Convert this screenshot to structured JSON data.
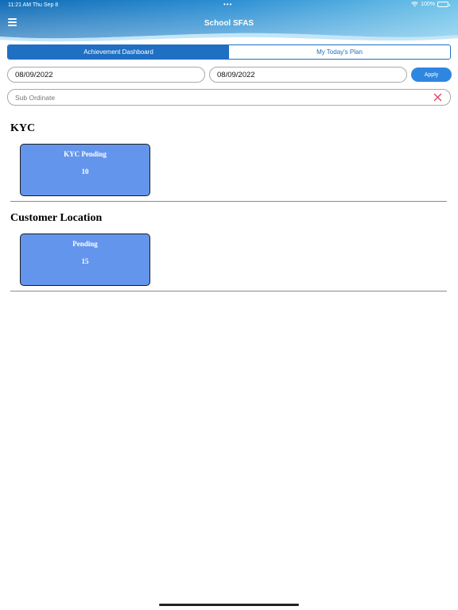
{
  "status_bar": {
    "time_date": "11:21 AM   Thu Sep 8",
    "dots": "•••",
    "battery_text": "100%",
    "battery_level": 1.0
  },
  "header": {
    "title": "School SFAS",
    "menu_icon": "hamburger-menu-icon",
    "gradient_colors": [
      "#0f6bb6",
      "#3aa1da",
      "#6fc4ea"
    ]
  },
  "tabs": [
    {
      "label": "Achievement Dashboard",
      "active": true
    },
    {
      "label": "My Today's Plan",
      "active": false
    }
  ],
  "filters": {
    "from_date": "08/09/2022",
    "to_date": "08/09/2022",
    "apply_label": "Apply",
    "subordinate_placeholder": "Sub Ordinate",
    "clear_icon": "close-x-icon"
  },
  "sections": [
    {
      "title": "KYC",
      "cards": [
        {
          "label": "KYC Pending",
          "value": "10"
        }
      ]
    },
    {
      "title": "Customer Location",
      "cards": [
        {
          "label": "Pending",
          "value": "15"
        }
      ]
    }
  ],
  "colors": {
    "accent": "#1f6fc2",
    "card_bg": "#6495ed",
    "apply_bg": "#2f86e0",
    "clear_icon": "#e0446a"
  }
}
